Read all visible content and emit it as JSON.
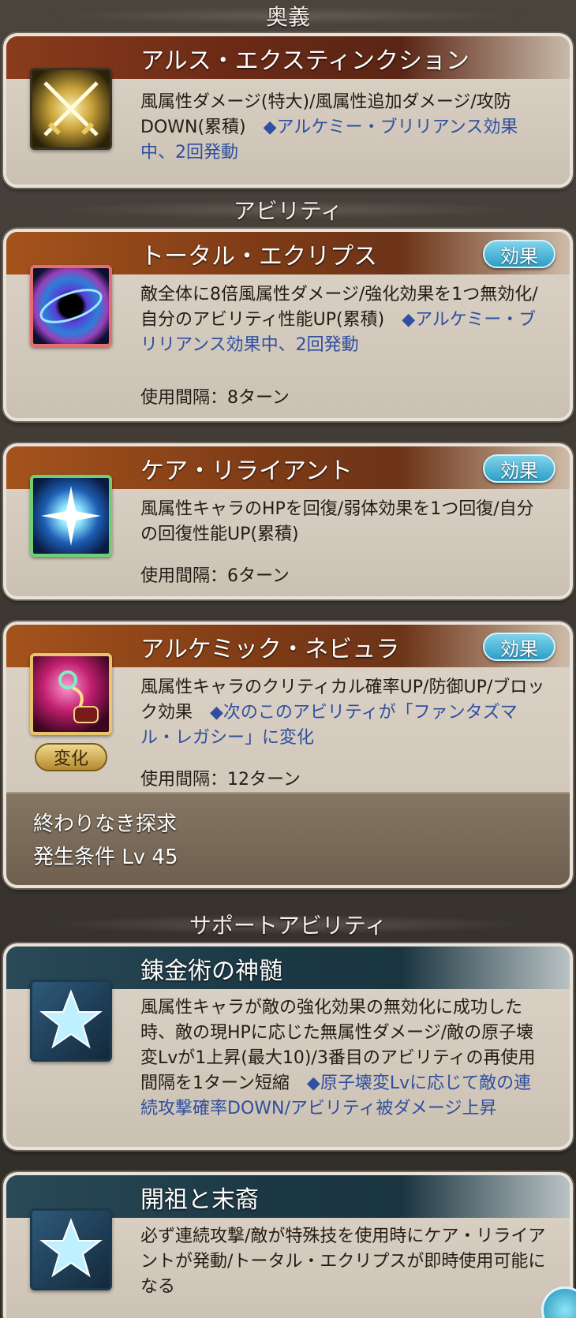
{
  "sections": {
    "ougi": "奥義",
    "ability": "アビリティ",
    "support": "サポートアビリティ"
  },
  "ougi": {
    "name": "アルス・エクスティンクション",
    "desc_main": "風属性ダメージ(特大)/風属性追加ダメージ/攻防DOWN(累積)　",
    "desc_note": "◆アルケミー・ブリリアンス効果中、2回発動",
    "icon": "crossed-swords-icon"
  },
  "abilities": [
    {
      "name": "トータル・エクリプス",
      "effect_label": "効果",
      "desc_main": "敵全体に8倍風属性ダメージ/強化効果を1つ無効化/自分のアビリティ性能UP(累積)　",
      "desc_note": "◆アルケミー・ブリリアンス効果中、2回発動",
      "interval": "使用間隔：8ターン",
      "icon": "black-hole-icon"
    },
    {
      "name": "ケア・リライアント",
      "effect_label": "効果",
      "desc_main": "風属性キャラのHPを回復/弱体効果を1つ回復/自分の回復性能UP(累積)",
      "desc_note": "",
      "interval": "使用間隔：6ターン",
      "icon": "sparkle-star-icon"
    },
    {
      "name": "アルケミック・ネビュラ",
      "effect_label": "効果",
      "desc_main": "風属性キャラのクリティカル確率UP/防御UP/ブロック効果　",
      "desc_note": "◆次のこのアビリティが「ファンタズマル・レガシー」に変化",
      "interval": "使用間隔：12ターン",
      "icon": "alchemy-flask-icon",
      "change_badge": "変化",
      "change_title": "終わりなき探求",
      "change_condition": "発生条件 Lv 45"
    }
  ],
  "supports": [
    {
      "name": "錬金術の神髄",
      "desc_main": "風属性キャラが敵の強化効果の無効化に成功した時、敵の現HPに応じた無属性ダメージ/敵の原子壊変Lvが1上昇(最大10)/3番目のアビリティの再使用間隔を1ターン短縮　",
      "desc_note": "◆原子壊変Lvに応じて敵の連続攻撃確率DOWN/アビリティ被ダメージ上昇",
      "icon": "star-icon"
    },
    {
      "name": "開祖と末裔",
      "desc_main": "必ず連続攻撃/敵が特殊技を使用時にケア・リライアントが発動/トータル・エクリプスが即時使用可能になる",
      "desc_note": "",
      "icon": "star-icon"
    }
  ]
}
